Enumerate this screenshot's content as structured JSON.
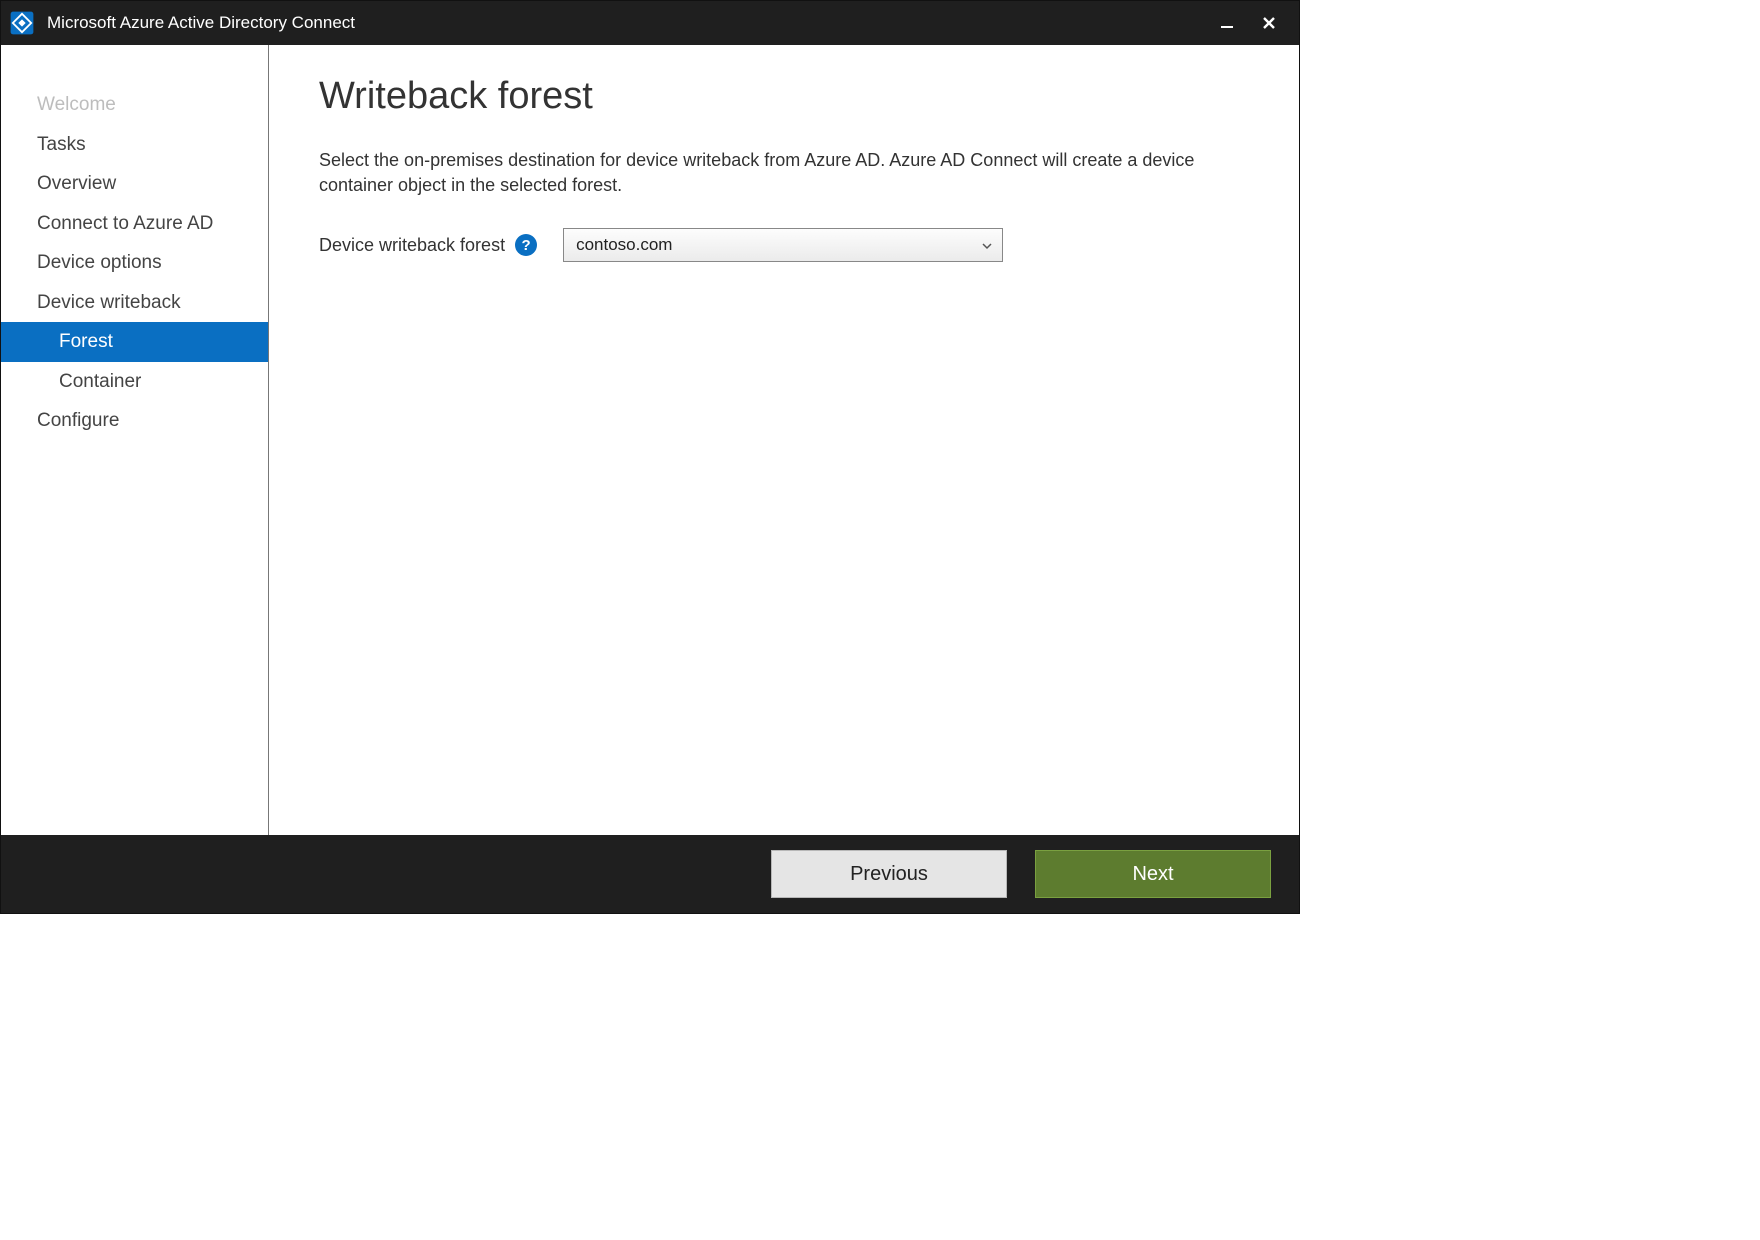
{
  "titlebar": {
    "title": "Microsoft Azure Active Directory Connect"
  },
  "sidebar": {
    "items": [
      {
        "label": "Welcome",
        "type": "top",
        "state": "disabled"
      },
      {
        "label": "Tasks",
        "type": "top",
        "state": "normal"
      },
      {
        "label": "Overview",
        "type": "top",
        "state": "normal"
      },
      {
        "label": "Connect to Azure AD",
        "type": "top",
        "state": "normal"
      },
      {
        "label": "Device options",
        "type": "top",
        "state": "normal"
      },
      {
        "label": "Device writeback",
        "type": "top",
        "state": "normal"
      },
      {
        "label": "Forest",
        "type": "sub",
        "state": "selected"
      },
      {
        "label": "Container",
        "type": "sub",
        "state": "normal"
      },
      {
        "label": "Configure",
        "type": "top",
        "state": "normal"
      }
    ]
  },
  "main": {
    "heading": "Writeback forest",
    "description": "Select the on-premises destination for device writeback from Azure AD.  Azure AD Connect will create a device container object in the selected forest.",
    "field_label": "Device writeback forest",
    "help_tooltip": "?",
    "dropdown_value": "contoso.com"
  },
  "footer": {
    "previous": "Previous",
    "next": "Next"
  }
}
